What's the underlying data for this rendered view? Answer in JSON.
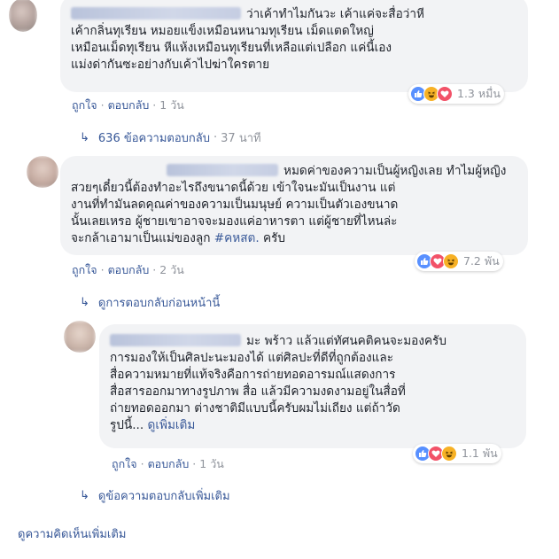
{
  "comments": [
    {
      "text": "ว่าเค้าทำไมกันวะ เค้าแค่จะสื่อว่าหี\nเค้ากลิ่นทุเรียน หมอยแข็งเหมือนหนามทุเรียน เม็ดแตดใหญ่\nเหมือนเม็ดทุเรียน หีแห้งเหมือนทุเรียนที่เหลือแต่เปลือก แค่นี้เอง\nแม่งด่ากันซะอย่างกับเค้าไปฆ่าใครตาย",
      "reactions": [
        "like",
        "haha",
        "love"
      ],
      "reaction_count": "1.3 หมื่น",
      "actions": {
        "like": "ถูกใจ",
        "reply": "ตอบกลับ",
        "time": "1 วัน"
      },
      "replies_link": {
        "label": "636 ข้อความตอบกลับ",
        "time": "37 นาที"
      }
    },
    {
      "text": "หมดค่าของความเป็นผู้หญิงเลย ทำไมผู้หญิง\nสวยๆเดี๋ยวนี้ต้องทำอะไรถึงขนาดนี้ด้วย เข้าใจนะมันเป็นงาน แต่\nงานที่ทำมันลดคุณค่าของความเป็นมนุษย์ ความเป็นตัวเองขนาด\nนั้นเลยเหรอ ผู้ชายเขาอาจจะมองแค่อาหารตา แต่ผู้ชายที่ไหนล่ะ\nจะกล้าเอามาเป็นแม่ของลูก ",
      "hashtag": "#คหสต.",
      "tail": " ครับ",
      "reactions": [
        "like",
        "love",
        "haha"
      ],
      "reaction_count": "7.2 พัน",
      "actions": {
        "like": "ถูกใจ",
        "reply": "ตอบกลับ",
        "time": "2 วัน"
      },
      "prev_replies_label": "ดูการตอบกลับก่อนหน้านี้"
    },
    {
      "text": "มะ พร้าว แล้วแต่ทัศนคติคนจะมองครับ\nการมองให้เป็นศิลปะนะมองได้ แต่ศิลปะที่ดีที่ถูกต้องและ\nสื่อความหมายที่แท้จริงคือการถ่ายทอดอารมณ์แสดงการ\nสื่อสารออกมาทางรูปภาพ สื่อ แล้วมีความงดงามอยู่ในสื่อที่\nถ่ายทอดออกมา ต่างชาติมีแบบนี้ครับผมไม่เถียง แต่ถ้าวัด\nรูปนี้... ",
      "see_more": "ดูเพิ่มเติม",
      "reactions": [
        "like",
        "love",
        "haha"
      ],
      "reaction_count": "1.1 พัน",
      "actions": {
        "like": "ถูกใจ",
        "reply": "ตอบกลับ",
        "time": "1 วัน"
      },
      "more_replies_label": "ดูข้อความตอบกลับเพิ่มเติม"
    }
  ],
  "more_comments_label": "ดูความคิดเห็นเพิ่มเติม",
  "colors": {
    "link": "#385898",
    "bubble": "#f2f3f5",
    "meta": "#90949c",
    "like": "#5890ff",
    "haha": "#f7b125",
    "love": "#f25268"
  }
}
